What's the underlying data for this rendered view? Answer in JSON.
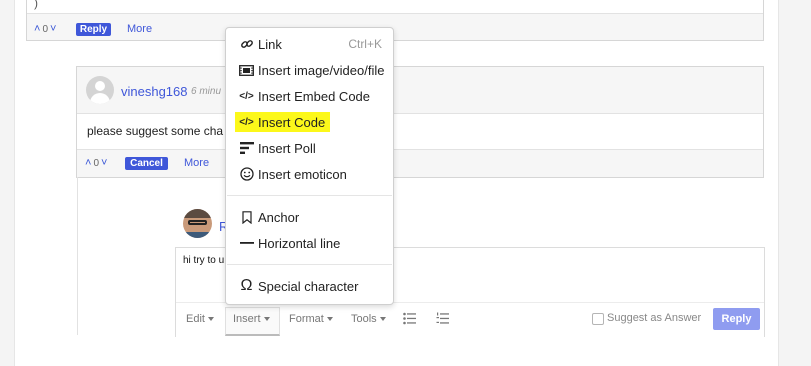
{
  "top_comment": {
    "vote_count": "0",
    "reply_label": "Reply",
    "more_label": "More"
  },
  "comment": {
    "username": "vineshg168",
    "time": "6 minu",
    "text": "please suggest some cha",
    "vote_count": "0",
    "cancel_label": "Cancel",
    "more_label": "More"
  },
  "reply_box": {
    "author_partial": "R",
    "text": "hi try to u",
    "toolbar": {
      "edit": "Edit",
      "insert": "Insert",
      "format": "Format",
      "tools": "Tools"
    },
    "suggest_label": "Suggest as Answer",
    "reply_label": "Reply"
  },
  "insert_menu": {
    "items": [
      {
        "label": "Link",
        "shortcut": "Ctrl+K",
        "icon": "link-icon"
      },
      {
        "label": "Insert image/video/file",
        "icon": "media-icon"
      },
      {
        "label": "Insert Embed Code",
        "icon": "code-icon"
      },
      {
        "label": "Insert Code",
        "icon": "code-icon",
        "highlighted": true
      },
      {
        "label": "Insert Poll",
        "icon": "poll-icon"
      },
      {
        "label": "Insert emoticon",
        "icon": "smiley-icon"
      },
      {
        "label": "Anchor",
        "icon": "bookmark-icon"
      },
      {
        "label": "Horizontal line",
        "icon": "horizontal-line-icon"
      },
      {
        "label": "Special character",
        "icon": "omega-icon"
      }
    ]
  },
  "colors": {
    "accent": "#3f57d9",
    "highlight": "#fcf81a",
    "reply_button_disabled": "#8f9cf0"
  }
}
